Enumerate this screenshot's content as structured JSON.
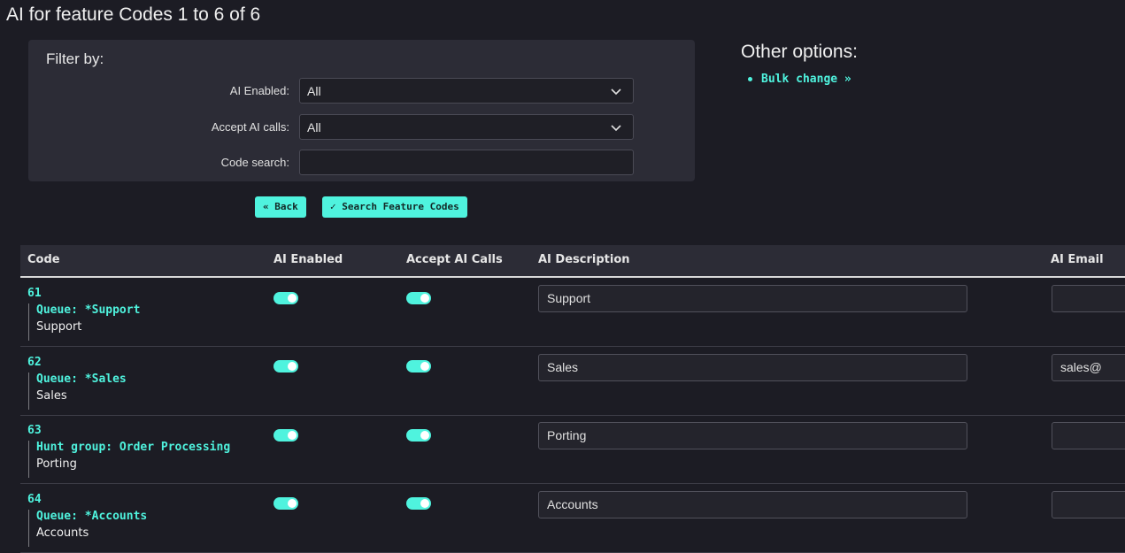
{
  "page": {
    "title": "AI for feature Codes 1 to 6 of 6"
  },
  "filter": {
    "heading": "Filter by:",
    "ai_enabled": {
      "label": "AI Enabled:",
      "value": "All"
    },
    "accept_ai_calls": {
      "label": "Accept AI calls:",
      "value": "All"
    },
    "code_search": {
      "label": "Code search:",
      "value": ""
    }
  },
  "buttons": {
    "back": "« Back",
    "search": "✓ Search Feature Codes"
  },
  "other_options": {
    "title": "Other options:",
    "links": [
      "Bulk change »"
    ]
  },
  "table": {
    "headers": {
      "code": "Code",
      "ai_enabled": "AI Enabled",
      "accept_ai_calls": "Accept AI Calls",
      "ai_description": "AI Description",
      "ai_email": "AI Email"
    },
    "rows": [
      {
        "code": "61",
        "target": "Queue: *Support",
        "name": "Support",
        "ai_enabled": true,
        "accept_ai_calls": true,
        "description": "Support",
        "email": ""
      },
      {
        "code": "62",
        "target": "Queue: *Sales",
        "name": "Sales",
        "ai_enabled": true,
        "accept_ai_calls": true,
        "description": "Sales",
        "email": "sales@"
      },
      {
        "code": "63",
        "target": "Hunt group: Order Processing",
        "name": "Porting",
        "ai_enabled": true,
        "accept_ai_calls": true,
        "description": "Porting",
        "email": ""
      },
      {
        "code": "64",
        "target": "Queue: *Accounts",
        "name": "Accounts",
        "ai_enabled": true,
        "accept_ai_calls": true,
        "description": "Accounts",
        "email": ""
      }
    ]
  },
  "colors": {
    "accent": "#4ff3de",
    "background": "#1c1c24",
    "panel": "#2c2c36"
  }
}
